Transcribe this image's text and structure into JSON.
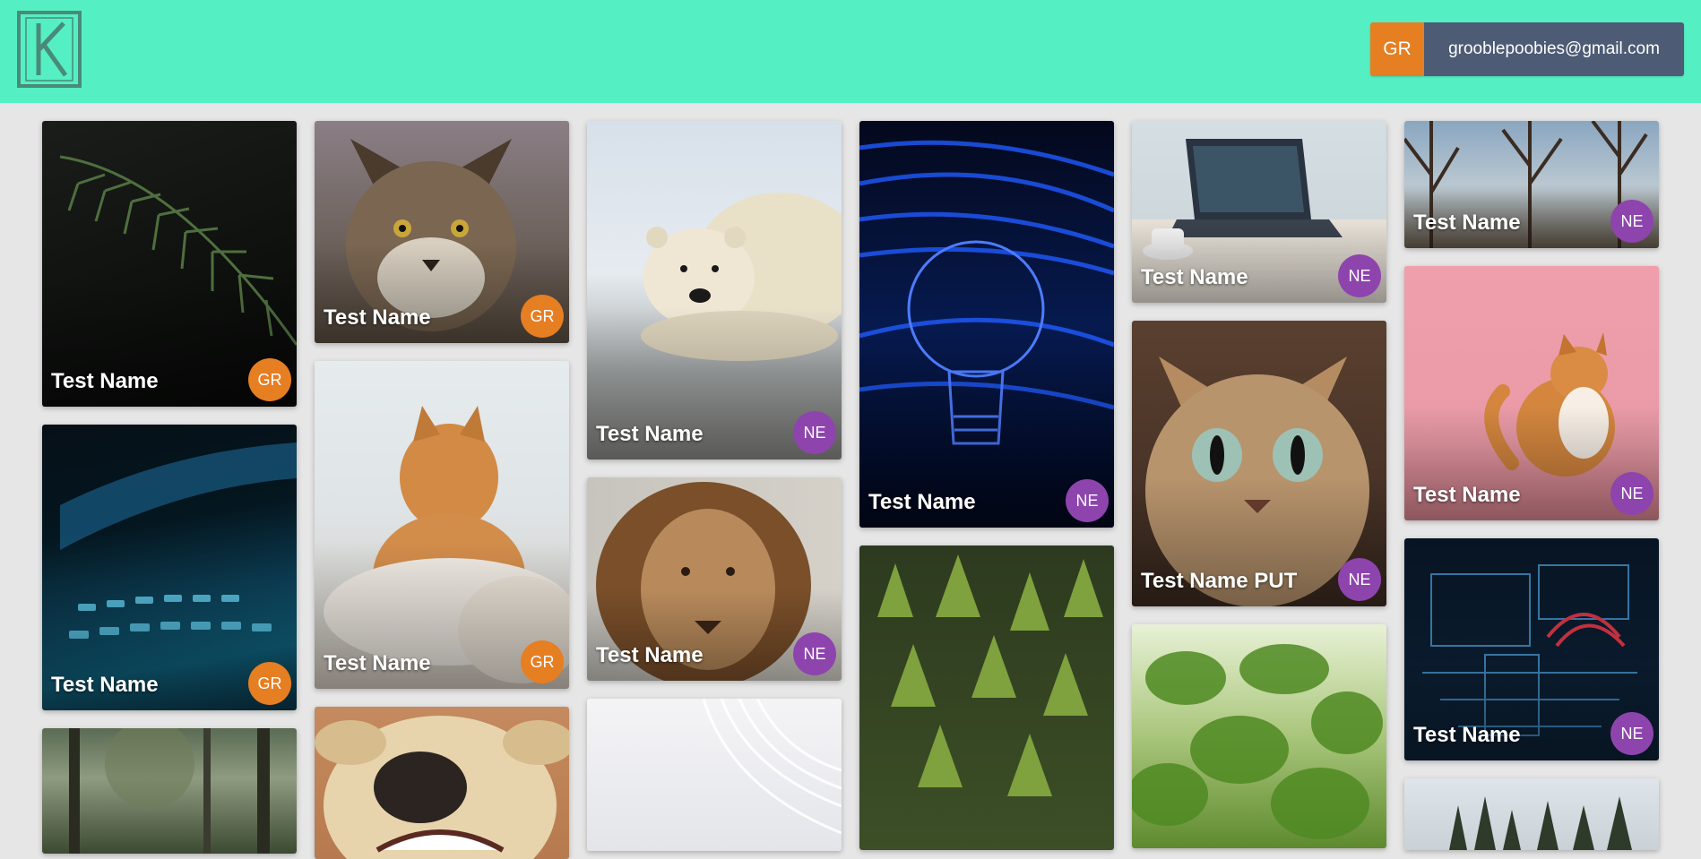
{
  "header": {
    "logo_letter": "K",
    "user": {
      "initials": "GR",
      "email": "grooblepoobies@gmail.com"
    }
  },
  "colors": {
    "header_bg": "#55efc4",
    "badge_gr": "#e67e22",
    "badge_ne": "#8e44ad",
    "email_bg": "#4d5b74",
    "page_bg": "#e6e6e6"
  },
  "cards": [
    {
      "title": "Test Name",
      "badge": "GR",
      "image": "fern-leaves"
    },
    {
      "title": "Test Name",
      "badge": "GR",
      "image": "glowing-keyboard"
    },
    {
      "title": "",
      "badge": "",
      "image": "forest-road"
    },
    {
      "title": "Test Name",
      "badge": "GR",
      "image": "lynx"
    },
    {
      "title": "Test Name",
      "badge": "GR",
      "image": "ginger-cat"
    },
    {
      "title": "",
      "badge": "",
      "image": "dog-nose"
    },
    {
      "title": "Test Name",
      "badge": "NE",
      "image": "polar-bear"
    },
    {
      "title": "Test Name",
      "badge": "NE",
      "image": "lion"
    },
    {
      "title": "",
      "badge": "",
      "image": "white-waves"
    },
    {
      "title": "Test Name",
      "badge": "NE",
      "image": "light-bulb"
    },
    {
      "title": "",
      "badge": "",
      "image": "pine-forest-aerial"
    },
    {
      "title": "Test Name",
      "badge": "NE",
      "image": "laptop-desk"
    },
    {
      "title": "Test Name PUT",
      "badge": "NE",
      "image": "bengal-cat"
    },
    {
      "title": "",
      "badge": "",
      "image": "green-leaves"
    },
    {
      "title": "Test Name",
      "badge": "NE",
      "image": "bare-trees"
    },
    {
      "title": "Test Name",
      "badge": "NE",
      "image": "cat-pink-background"
    },
    {
      "title": "Test Name",
      "badge": "NE",
      "image": "circuit-board"
    },
    {
      "title": "",
      "badge": "",
      "image": "snowy-forest"
    }
  ]
}
